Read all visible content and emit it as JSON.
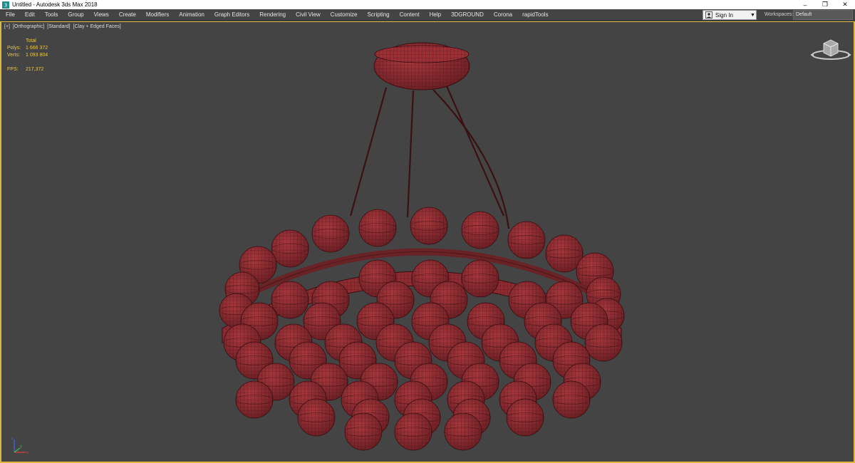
{
  "window": {
    "title": "Untitled - Autodesk 3ds Max 2018",
    "controls": {
      "minimize": "–",
      "restore": "❐",
      "close": "✕"
    }
  },
  "menu": {
    "items": [
      "File",
      "Edit",
      "Tools",
      "Group",
      "Views",
      "Create",
      "Modifiers",
      "Animation",
      "Graph Editors",
      "Rendering",
      "Civil View",
      "Customize",
      "Scripting",
      "Content",
      "Help",
      "3DGROUND",
      "Corona",
      "rapidTools"
    ]
  },
  "signin": {
    "label": "Sign In",
    "caret": "▼"
  },
  "workspaces": {
    "label": "Workspaces:",
    "value": "Default"
  },
  "viewport": {
    "labels": [
      "[+]",
      "[Orthographic]",
      "[Standard]",
      "[Clay + Edged Faces]"
    ],
    "stats": {
      "header": "Total",
      "polys_label": "Polys:",
      "polys": "1 666 372",
      "verts_label": "Verts:",
      "verts": "1 093 804",
      "fps_label": "FPS:",
      "fps": "217,372"
    }
  },
  "colors": {
    "viewport_bg": "#444444",
    "active_border": "#e0b73a",
    "stats_text": "#e8c84a",
    "mesh_fill": "#8a2a2f",
    "mesh_wire": "#3a0d10"
  },
  "icons": {
    "app": "3dsmax-app-icon",
    "user": "user-icon",
    "viewcube": "viewcube-icon",
    "axis": "axis-tripod-icon"
  }
}
